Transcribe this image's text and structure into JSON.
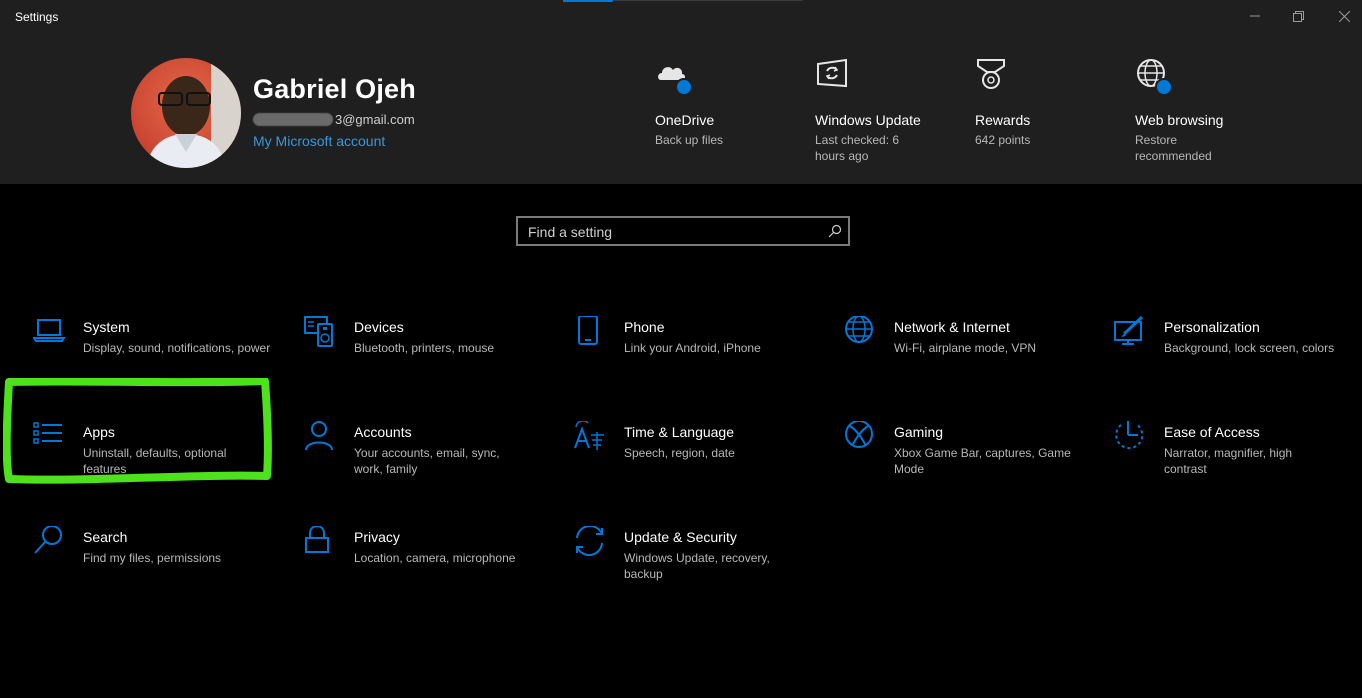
{
  "window": {
    "title": "Settings"
  },
  "profile": {
    "name": "Gabriel Ojeh",
    "email_visible": "3@gmail.com",
    "account_link": "My Microsoft account"
  },
  "quick_links": [
    {
      "label": "OneDrive",
      "sub": "Back up files",
      "icon": "onedrive-icon"
    },
    {
      "label": "Windows Update",
      "sub": "Last checked: 6 hours ago",
      "icon": "windows-update-icon"
    },
    {
      "label": "Rewards",
      "sub": "642 points",
      "icon": "rewards-icon"
    },
    {
      "label": "Web browsing",
      "sub": "Restore recommended",
      "icon": "globe-icon"
    }
  ],
  "search": {
    "placeholder": "Find a setting"
  },
  "categories": [
    {
      "label": "System",
      "sub": "Display, sound, notifications, power",
      "icon": "laptop-icon"
    },
    {
      "label": "Devices",
      "sub": "Bluetooth, printers, mouse",
      "icon": "devices-icon"
    },
    {
      "label": "Phone",
      "sub": "Link your Android, iPhone",
      "icon": "phone-icon"
    },
    {
      "label": "Network & Internet",
      "sub": "Wi-Fi, airplane mode, VPN",
      "icon": "globe-icon"
    },
    {
      "label": "Personalization",
      "sub": "Background, lock screen, colors",
      "icon": "personalization-icon"
    },
    {
      "label": "Apps",
      "sub": "Uninstall, defaults, optional features",
      "icon": "apps-list-icon"
    },
    {
      "label": "Accounts",
      "sub": "Your accounts, email, sync, work, family",
      "icon": "person-icon"
    },
    {
      "label": "Time & Language",
      "sub": "Speech, region, date",
      "icon": "time-language-icon"
    },
    {
      "label": "Gaming",
      "sub": "Xbox Game Bar, captures, Game Mode",
      "icon": "xbox-icon"
    },
    {
      "label": "Ease of Access",
      "sub": "Narrator, magnifier, high contrast",
      "icon": "ease-of-access-icon"
    },
    {
      "label": "Search",
      "sub": "Find my files, permissions",
      "icon": "search-icon"
    },
    {
      "label": "Privacy",
      "sub": "Location, camera, microphone",
      "icon": "lock-icon"
    },
    {
      "label": "Update & Security",
      "sub": "Windows Update, recovery, backup",
      "icon": "sync-icon"
    }
  ],
  "colors": {
    "accent": "#0078d7",
    "link": "#3a96dd",
    "highlight": "#4de21c",
    "header_bg": "#1f1f1f"
  }
}
